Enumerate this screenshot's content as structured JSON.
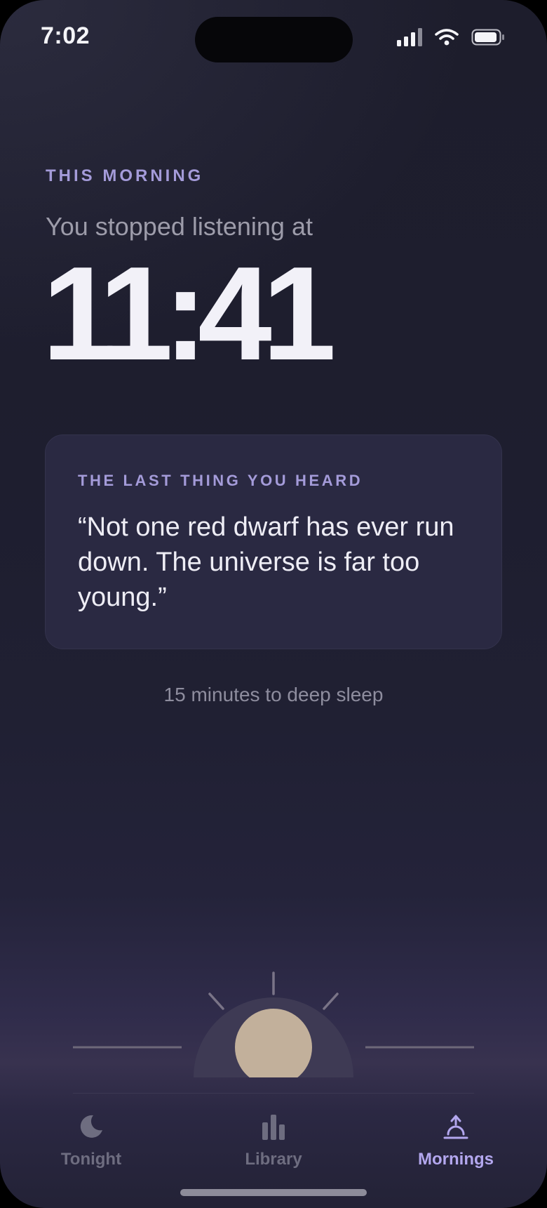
{
  "status_bar": {
    "time": "7:02",
    "icons": [
      "cellular-signal-icon",
      "wifi-icon",
      "battery-icon"
    ]
  },
  "header": {
    "kicker": "THIS MORNING",
    "subhead": "You stopped listening at",
    "stopped_time": "11:41"
  },
  "card": {
    "kicker": "THE LAST THING YOU HEARD",
    "quote": "“Not one red dwarf has ever run down. The universe is far too young.”"
  },
  "hint": "15 minutes to deep sleep",
  "illustration": {
    "name": "sunrise",
    "sun_color": "#c2b09b"
  },
  "tabs": [
    {
      "label": "Tonight",
      "icon": "moon-icon",
      "active": false
    },
    {
      "label": "Library",
      "icon": "library-bars-icon",
      "active": false
    },
    {
      "label": "Mornings",
      "icon": "sunrise-icon",
      "active": true
    }
  ],
  "colors": {
    "accent": "#a49bd9",
    "active_tab": "#b3a7ee",
    "background": "#1e1e2f",
    "card": "#2a2942"
  }
}
